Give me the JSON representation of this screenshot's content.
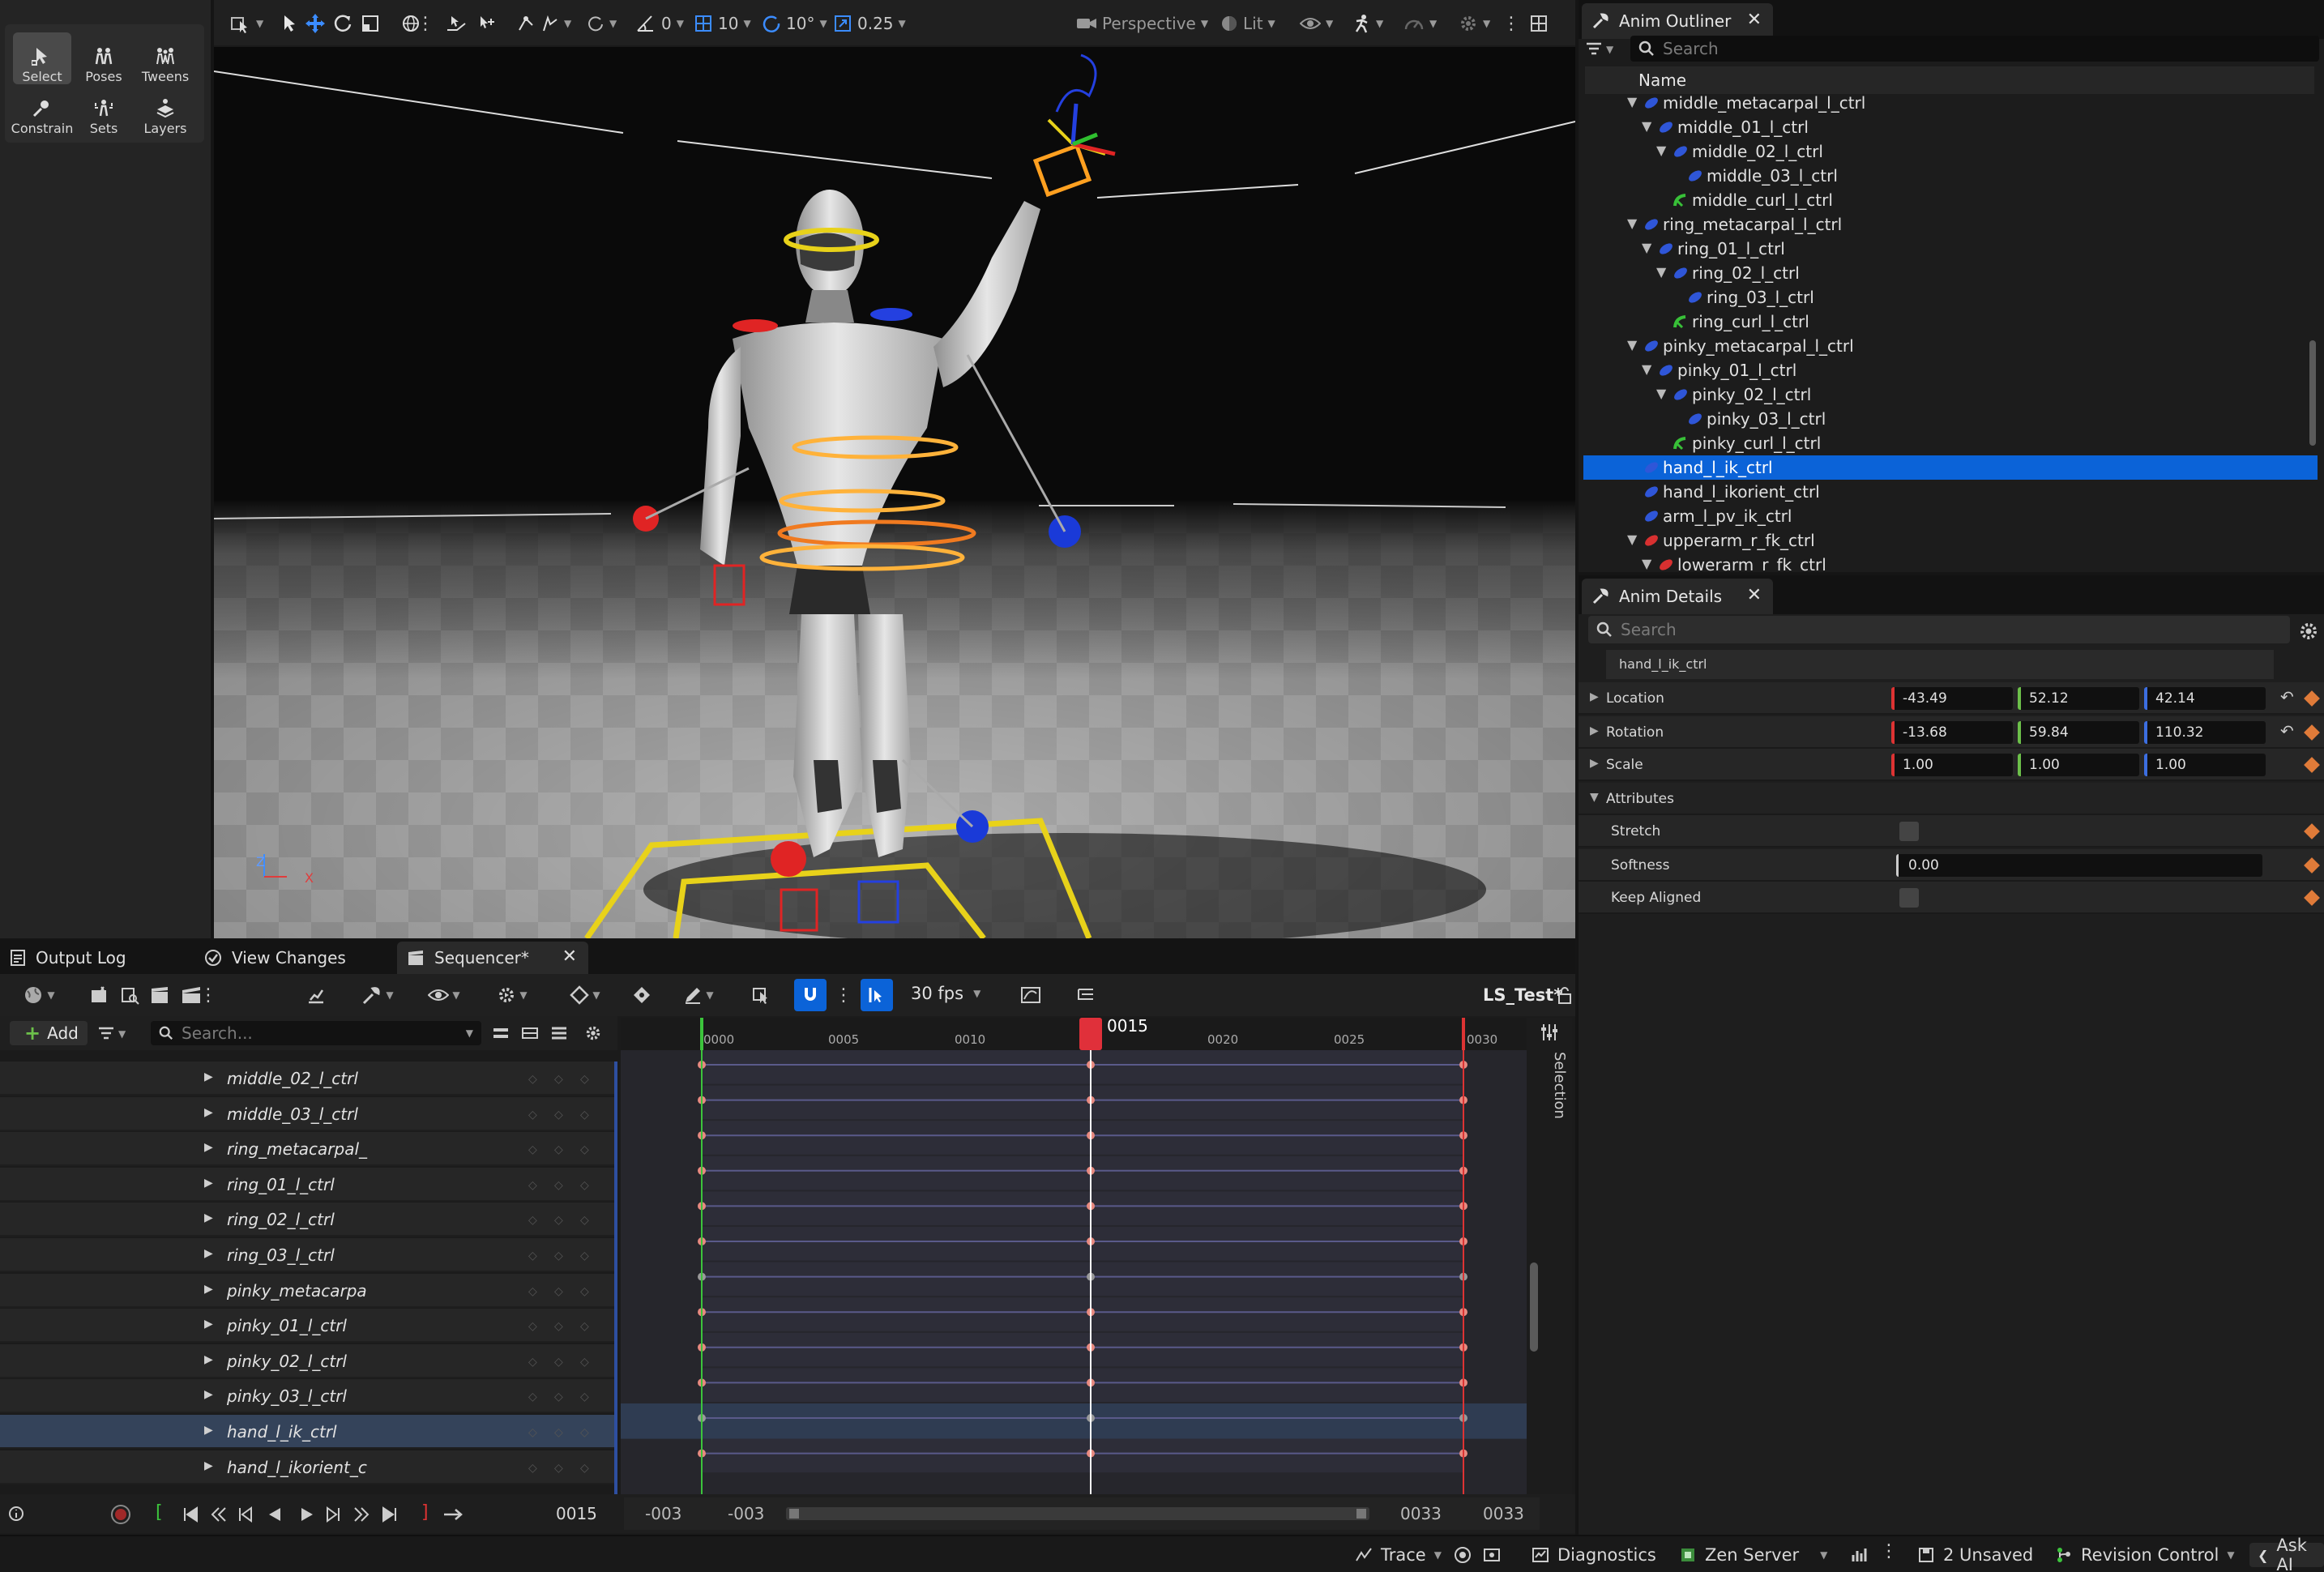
{
  "modes_toolbar": {
    "items": [
      {
        "label": "Select",
        "active": true
      },
      {
        "label": "Poses"
      },
      {
        "label": "Tweens"
      },
      {
        "label": "Constrain"
      },
      {
        "label": "Sets"
      },
      {
        "label": "Layers"
      }
    ]
  },
  "viewport": {
    "toolbar": {
      "rotate_snap_value": "0",
      "grid_snap_value": "10",
      "angle_snap_value": "10°",
      "scale_snap_value": "0.25",
      "view_mode": "Perspective",
      "lighting_mode": "Lit"
    },
    "axis": {
      "z": "Z",
      "x": "X"
    }
  },
  "outliner": {
    "tab_title": "Anim Outliner",
    "search_placeholder": "Search",
    "column_header": "Name",
    "rows": [
      {
        "label": "middle_metacarpal_l_ctrl",
        "depth": 1,
        "expanded": true,
        "kind": "blue"
      },
      {
        "label": "middle_01_l_ctrl",
        "depth": 2,
        "expanded": true,
        "kind": "blue"
      },
      {
        "label": "middle_02_l_ctrl",
        "depth": 3,
        "expanded": true,
        "kind": "blue"
      },
      {
        "label": "middle_03_l_ctrl",
        "depth": 4,
        "kind": "blue"
      },
      {
        "label": "middle_curl_l_ctrl",
        "depth": 3,
        "kind": "green"
      },
      {
        "label": "ring_metacarpal_l_ctrl",
        "depth": 1,
        "expanded": true,
        "kind": "blue"
      },
      {
        "label": "ring_01_l_ctrl",
        "depth": 2,
        "expanded": true,
        "kind": "blue"
      },
      {
        "label": "ring_02_l_ctrl",
        "depth": 3,
        "expanded": true,
        "kind": "blue"
      },
      {
        "label": "ring_03_l_ctrl",
        "depth": 4,
        "kind": "blue"
      },
      {
        "label": "ring_curl_l_ctrl",
        "depth": 3,
        "kind": "green"
      },
      {
        "label": "pinky_metacarpal_l_ctrl",
        "depth": 1,
        "expanded": true,
        "kind": "blue"
      },
      {
        "label": "pinky_01_l_ctrl",
        "depth": 2,
        "expanded": true,
        "kind": "blue"
      },
      {
        "label": "pinky_02_l_ctrl",
        "depth": 3,
        "expanded": true,
        "kind": "blue"
      },
      {
        "label": "pinky_03_l_ctrl",
        "depth": 4,
        "kind": "blue"
      },
      {
        "label": "pinky_curl_l_ctrl",
        "depth": 3,
        "kind": "green"
      },
      {
        "label": "hand_l_ik_ctrl",
        "depth": 1,
        "kind": "blue",
        "selected": true
      },
      {
        "label": "hand_l_ikorient_ctrl",
        "depth": 1,
        "kind": "blue"
      },
      {
        "label": "arm_l_pv_ik_ctrl",
        "depth": 1,
        "kind": "blue"
      },
      {
        "label": "upperarm_r_fk_ctrl",
        "depth": 1,
        "expanded": true,
        "kind": "red"
      },
      {
        "label": "lowerarm_r_fk_ctrl",
        "depth": 2,
        "expanded": true,
        "kind": "red"
      }
    ]
  },
  "details": {
    "tab_title": "Anim Details",
    "search_placeholder": "Search",
    "selected_control": "hand_l_ik_ctrl",
    "location": {
      "label": "Location",
      "x": "-43.49",
      "y": "52.12",
      "z": "42.14"
    },
    "rotation": {
      "label": "Rotation",
      "x": "-13.68",
      "y": "59.84",
      "z": "110.32"
    },
    "scale": {
      "label": "Scale",
      "x": "1.00",
      "y": "1.00",
      "z": "1.00"
    },
    "attributes_label": "Attributes",
    "stretch_label": "Stretch",
    "softness_label": "Softness",
    "softness_value": "0.00",
    "keep_aligned_label": "Keep Aligned"
  },
  "bottom_tabs": {
    "output_log": "Output Log",
    "view_changes": "View Changes",
    "sequencer": "Sequencer*"
  },
  "sequencer": {
    "fps": "30 fps",
    "sequence_name": "LS_Test*",
    "add_label": "Add",
    "search_placeholder": "Search...",
    "selection_label": "Selection",
    "current_frame": "0015",
    "current_frame_field": "0015",
    "ruler_ticks": [
      "0000",
      "0005",
      "0010",
      "0020",
      "0025",
      "0030"
    ],
    "range_start_a": "-003",
    "range_start_b": "-003",
    "range_end_a": "0033",
    "range_end_b": "0033",
    "tracks": [
      {
        "label": "middle_02_l_ctrl",
        "key_color": "#e88a80"
      },
      {
        "label": "middle_03_l_ctrl",
        "key_color": "#e88a80"
      },
      {
        "label": "ring_metacarpal_",
        "key_color": "#e88a80"
      },
      {
        "label": "ring_01_l_ctrl",
        "key_color": "#e88a80"
      },
      {
        "label": "ring_02_l_ctrl",
        "key_color": "#e88a80"
      },
      {
        "label": "ring_03_l_ctrl",
        "key_color": "#e88a80"
      },
      {
        "label": "pinky_metacarpa",
        "key_color": "#9a9a9a"
      },
      {
        "label": "pinky_01_l_ctrl",
        "key_color": "#e88a80"
      },
      {
        "label": "pinky_02_l_ctrl",
        "key_color": "#e88a80"
      },
      {
        "label": "pinky_03_l_ctrl",
        "key_color": "#e88a80"
      },
      {
        "label": "hand_l_ik_ctrl",
        "key_color": "#9a9a9a",
        "selected": true
      },
      {
        "label": "hand_l_ikorient_c",
        "key_color": "#e88a80"
      }
    ]
  },
  "statusbar": {
    "trace": "Trace",
    "diagnostics": "Diagnostics",
    "zen_server": "Zen Server",
    "unsaved": "2 Unsaved",
    "revision_control": "Revision Control",
    "ask_ai": "Ask AI"
  },
  "colors": {
    "accent": "#0b63d8",
    "playhead": "#e0303a",
    "key": "#e07b39",
    "x_axis": "#e03c3c",
    "y_axis": "#6cc04a",
    "z_axis": "#3c6ee0"
  }
}
